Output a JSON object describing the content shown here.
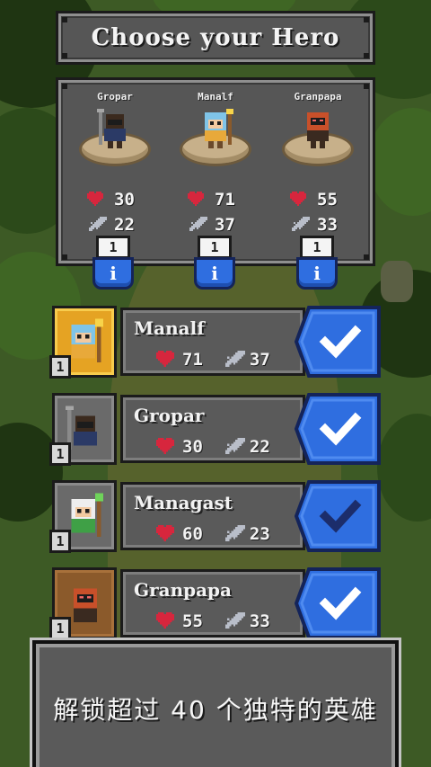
{
  "screen": {
    "title": "Choose your Hero",
    "party": [
      {
        "name": "Gropar",
        "hp": "30",
        "atk": "22",
        "level": "1",
        "info": "i",
        "color": "#3b2a1e"
      },
      {
        "name": "Manalf",
        "hp": "71",
        "atk": "37",
        "level": "1",
        "info": "i",
        "color": "#7fc4e8"
      },
      {
        "name": "Granpapa",
        "hp": "55",
        "atk": "33",
        "level": "1",
        "info": "i",
        "color": "#c8502a"
      }
    ],
    "heroes": [
      {
        "name": "Manalf",
        "hp": "71",
        "atk": "37",
        "level": "1",
        "selected": true,
        "card": "gold"
      },
      {
        "name": "Gropar",
        "hp": "30",
        "atk": "22",
        "level": "1",
        "selected": true,
        "card": "grey"
      },
      {
        "name": "Managast",
        "hp": "60",
        "atk": "23",
        "level": "1",
        "selected": false,
        "card": "grey"
      },
      {
        "name": "Granpapa",
        "hp": "55",
        "atk": "33",
        "level": "1",
        "selected": true,
        "card": "brown"
      }
    ],
    "banner": "解锁超过 40 个独特的英雄"
  },
  "colors": {
    "heart": "#d7263d",
    "sword": "#b9bec9",
    "select_blue": "#2f6ee0",
    "check_active": "#ffffff",
    "check_inactive": "#1c2d6b"
  },
  "icons": [
    "heart-icon",
    "sword-icon",
    "checkmark-icon",
    "info-icon"
  ]
}
